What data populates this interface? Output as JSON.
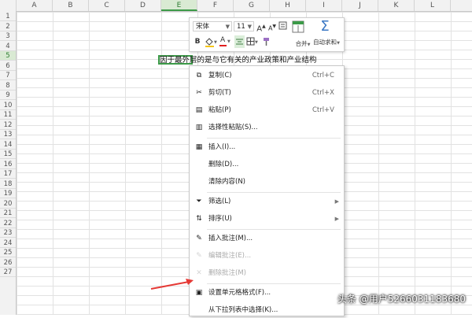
{
  "sheet": {
    "columns": [
      "A",
      "B",
      "C",
      "D",
      "E",
      "F",
      "G",
      "H",
      "I",
      "J",
      "K",
      "L"
    ],
    "selected_column": "E",
    "rows": [
      "1",
      "2",
      "3",
      "4",
      "5",
      "6",
      "7",
      "8",
      "9",
      "10",
      "11",
      "12",
      "13",
      "14",
      "15",
      "16",
      "17",
      "18",
      "19",
      "20",
      "21",
      "22",
      "23",
      "24",
      "25",
      "26",
      "27"
    ],
    "selected_row": "5",
    "cell_text": "因于最外层的是与它有关的产业政策和产业结构"
  },
  "mini_toolbar": {
    "font_name": "宋体",
    "font_size": "11",
    "grow_font": "A",
    "shrink_font": "A",
    "bold": "B",
    "font_color_letter": "A",
    "merge_label": "合并",
    "autosum_label": "自动求和",
    "colors": {
      "fill_bar": "#f5c518",
      "font_bar": "#e02020",
      "accent": "#3c9a48"
    }
  },
  "context_menu": {
    "items": [
      {
        "id": "copy",
        "label": "复制(C)",
        "shortcut": "Ctrl+C",
        "icon": "copy-icon",
        "glyph": "⧉",
        "enabled": true
      },
      {
        "id": "cut",
        "label": "剪切(T)",
        "shortcut": "Ctrl+X",
        "icon": "scissors-icon",
        "glyph": "✂",
        "enabled": true
      },
      {
        "id": "paste",
        "label": "粘贴(P)",
        "shortcut": "Ctrl+V",
        "icon": "paste-icon",
        "glyph": "▤",
        "enabled": true
      },
      {
        "id": "paste-special",
        "label": "选择性粘贴(S)...",
        "shortcut": "",
        "icon": "paste-special-icon",
        "glyph": "▥",
        "enabled": true
      },
      {
        "id": "insert",
        "label": "插入(I)...",
        "shortcut": "",
        "icon": "insert-icon",
        "glyph": "▦",
        "enabled": true
      },
      {
        "id": "delete",
        "label": "删除(D)...",
        "shortcut": "",
        "icon": "",
        "glyph": "",
        "enabled": true
      },
      {
        "id": "clear",
        "label": "清除内容(N)",
        "shortcut": "",
        "icon": "",
        "glyph": "",
        "enabled": true
      },
      {
        "id": "filter",
        "label": "筛选(L)",
        "shortcut": "",
        "icon": "filter-icon",
        "glyph": "⏷",
        "enabled": true,
        "submenu": true
      },
      {
        "id": "sort",
        "label": "排序(U)",
        "shortcut": "",
        "icon": "sort-icon",
        "glyph": "⇅",
        "enabled": true,
        "submenu": true
      },
      {
        "id": "insert-comment",
        "label": "插入批注(M)...",
        "shortcut": "",
        "icon": "comment-icon",
        "glyph": "✎",
        "enabled": true
      },
      {
        "id": "edit-comment",
        "label": "编辑批注(E)...",
        "shortcut": "",
        "icon": "edit-comment-icon",
        "glyph": "✎",
        "enabled": false
      },
      {
        "id": "delete-comment",
        "label": "删除批注(M)",
        "shortcut": "",
        "icon": "delete-comment-icon",
        "glyph": "✕",
        "enabled": false
      },
      {
        "id": "format-cells",
        "label": "设置单元格格式(F)...",
        "shortcut": "",
        "icon": "format-cells-icon",
        "glyph": "▣",
        "enabled": true
      },
      {
        "id": "pick-from-list",
        "label": "从下拉列表中选择(K)...",
        "shortcut": "",
        "icon": "",
        "glyph": "",
        "enabled": true
      }
    ]
  },
  "watermark": "头条 @用户5266031183680",
  "annotation_color": "#e53935"
}
